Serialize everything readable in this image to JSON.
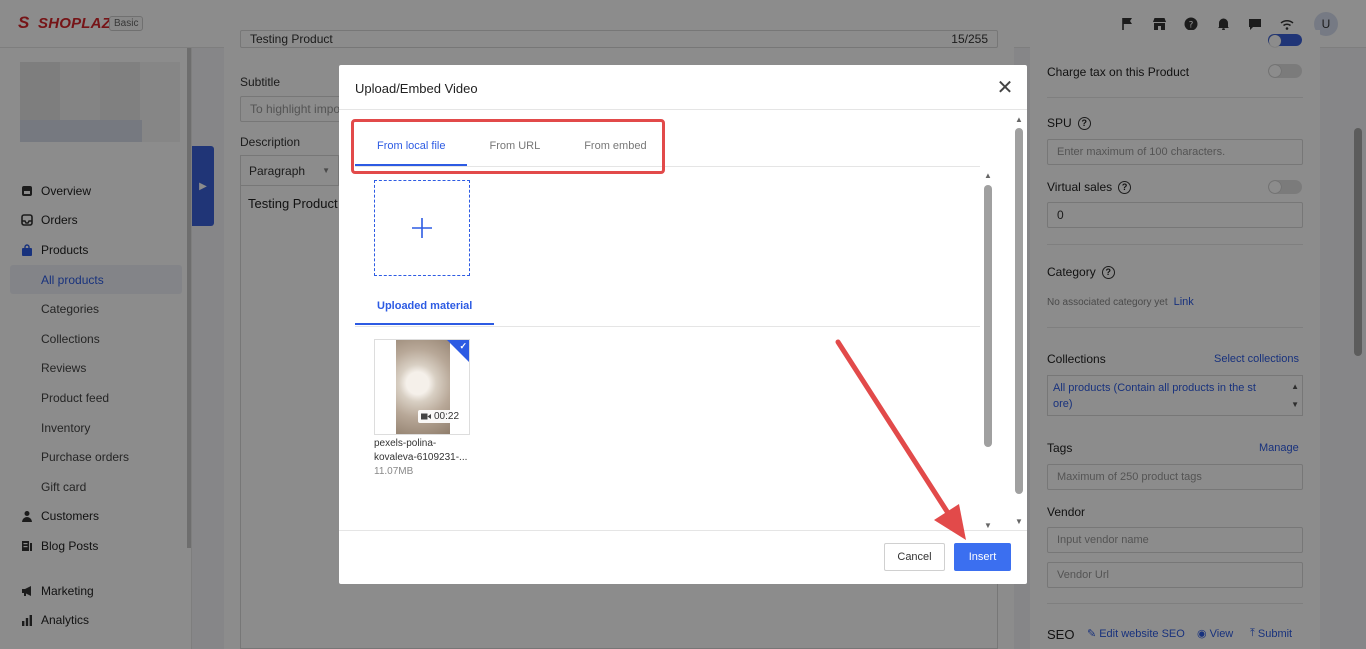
{
  "topbar": {
    "brand": "SHOPLAZZA",
    "plan": "Basic",
    "avatar_initial": "U",
    "icons": [
      "flag-icon",
      "store-icon",
      "help-icon",
      "bell-icon",
      "chat-icon",
      "wifi-icon"
    ]
  },
  "sidebar": {
    "items": [
      {
        "label": "Overview",
        "icon": "home-icon"
      },
      {
        "label": "Orders",
        "icon": "inbox-icon"
      },
      {
        "label": "Products",
        "icon": "bag-icon"
      },
      {
        "label": "All products"
      },
      {
        "label": "Categories"
      },
      {
        "label": "Collections"
      },
      {
        "label": "Reviews"
      },
      {
        "label": "Product feed"
      },
      {
        "label": "Inventory"
      },
      {
        "label": "Purchase orders"
      },
      {
        "label": "Gift card"
      },
      {
        "label": "Customers",
        "icon": "user-icon"
      },
      {
        "label": "Blog Posts",
        "icon": "blog-icon"
      },
      {
        "label": "Marketing",
        "icon": "megaphone-icon"
      },
      {
        "label": "Analytics",
        "icon": "bar-chart-icon"
      }
    ]
  },
  "main": {
    "title_value": "Testing Product",
    "title_count": "15/255",
    "subtitle_label": "Subtitle",
    "subtitle_placeholder": "To highlight impor",
    "description_label": "Description",
    "paragraph_select": "Paragraph",
    "editor_content": "Testing Product"
  },
  "right": {
    "charge_tax": "Charge tax on this Product",
    "spu_label": "SPU",
    "spu_placeholder": "Enter maximum of 100 characters.",
    "virtual_sales_label": "Virtual sales",
    "virtual_sales_value": "0",
    "category_label": "Category",
    "category_empty": "No associated category yet",
    "category_link": "Link",
    "collections_label": "Collections",
    "select_collections": "Select collections",
    "collections_value": "All products  (Contain all products in the st ore)",
    "tags_label": "Tags",
    "tags_manage": "Manage",
    "tags_placeholder": "Maximum of 250 product tags",
    "vendor_label": "Vendor",
    "vendor_placeholder": "Input vendor name",
    "vendor_url_placeholder": "Vendor Url",
    "seo_label": "SEO",
    "seo_edit": "Edit website SEO",
    "seo_view": "View",
    "seo_submit": "Submit"
  },
  "modal": {
    "title": "Upload/Embed Video",
    "tabs": [
      {
        "label": "From local file",
        "active": true
      },
      {
        "label": "From URL",
        "active": false
      },
      {
        "label": "From embed",
        "active": false
      }
    ],
    "uploaded_material_tab": "Uploaded material",
    "file": {
      "name": "pexels-polina-kovaleva-6109231-...",
      "size": "11.07MB",
      "duration": "00:22",
      "selected": true
    },
    "cancel_label": "Cancel",
    "insert_label": "Insert"
  },
  "colors": {
    "accent": "#2d5be3",
    "primary_button": "#3b6ff0",
    "annotation": "#e24a4a",
    "brand": "#d7262b"
  }
}
